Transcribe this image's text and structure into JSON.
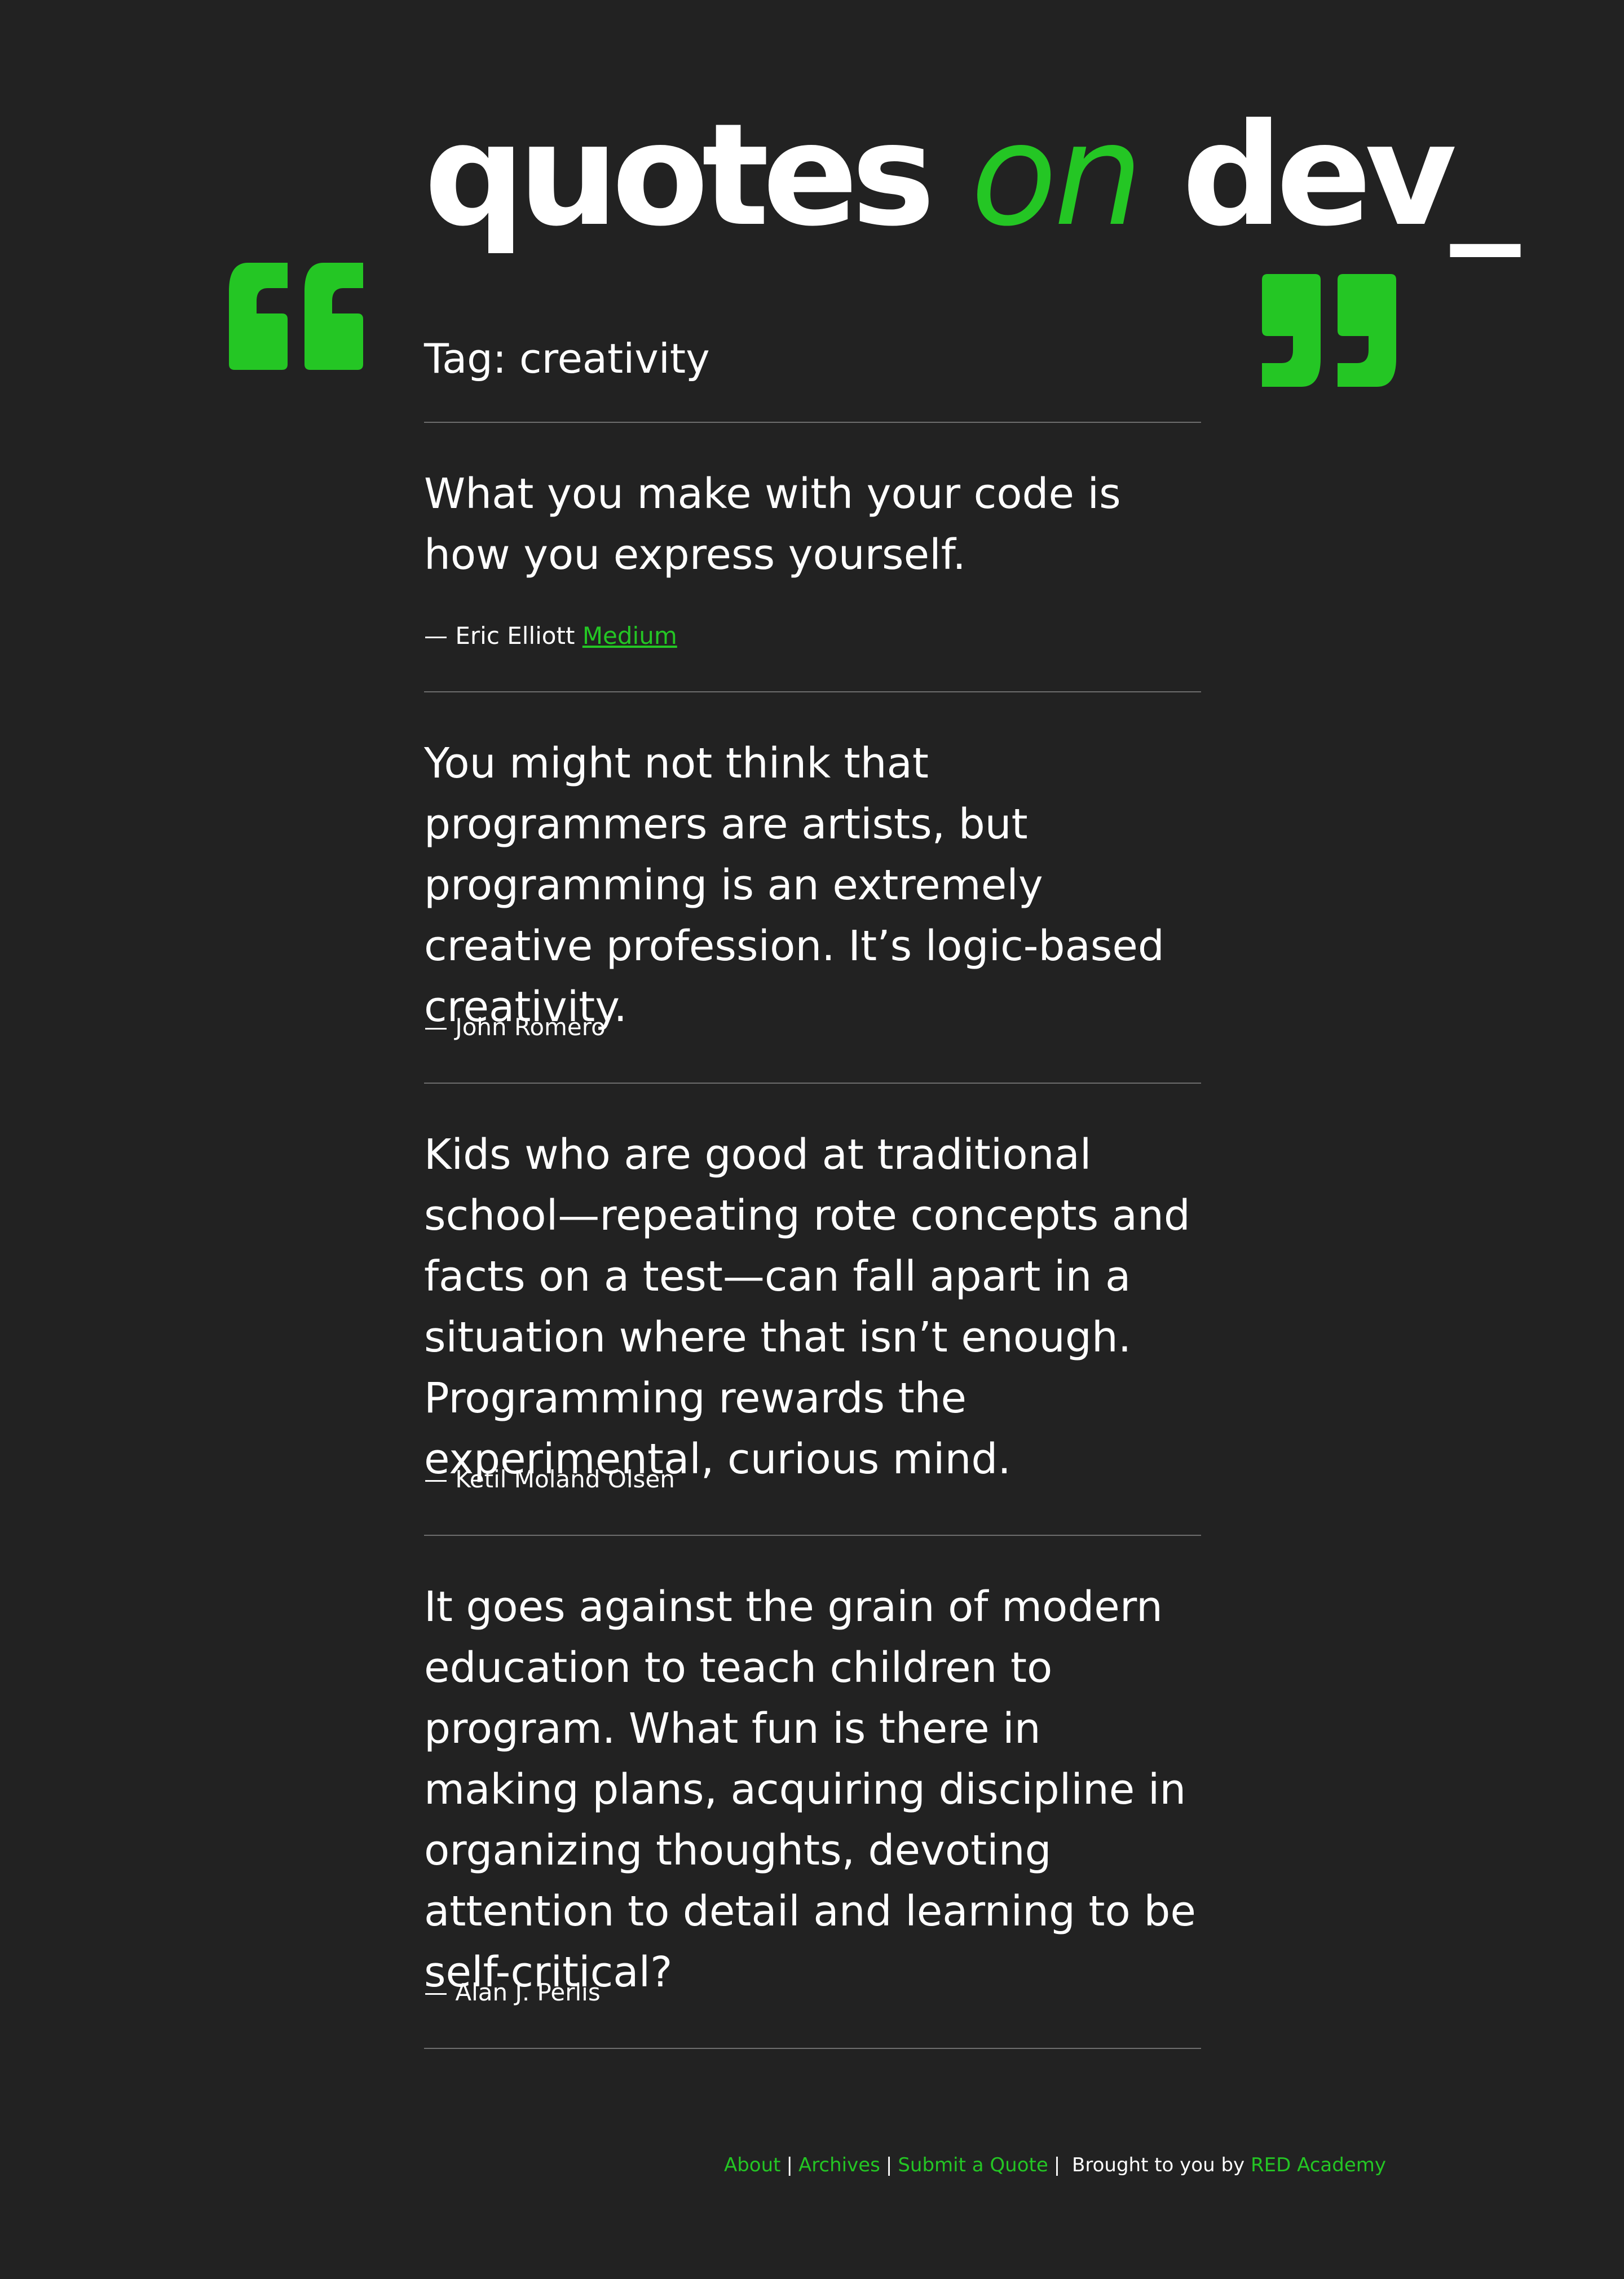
{
  "site": {
    "logo_part1": "quotes ",
    "logo_accent": "on",
    "logo_part2": " dev_"
  },
  "colors": {
    "background": "#222222",
    "accent": "#24c624",
    "text": "#ffffff",
    "rule": "#6e6e6e"
  },
  "icons": {
    "open": "open-quote-icon",
    "close": "close-quote-icon"
  },
  "page": {
    "title": "Tag: creativity"
  },
  "quotes": [
    {
      "text": "What you make with your code is how you express yourself.",
      "author": "— Eric Elliott",
      "source": "Medium"
    },
    {
      "text": "You might not think that programmers are artists, but programming is an extremely creative profession. It’s logic-based creativity.",
      "author": "— John Romero"
    },
    {
      "text": "Kids who are good at traditional school—repeating rote concepts and facts on a test—can fall apart in a situation where that isn’t enough. Programming rewards the experimental, curious mind.",
      "author": "— Ketil Moland Olsen"
    },
    {
      "text": "It goes against the grain of modern education to teach children to program. What fun is there in making plans, acquiring discipline in organizing thoughts, devoting attention to detail and learning to be self-critical?",
      "author": "— Alan J. Perlis"
    }
  ],
  "footer": {
    "links": [
      "About",
      "Archives",
      "Submit a Quote"
    ],
    "separator": "|",
    "credit_prefix": "Brought to you by",
    "credit_link": "RED Academy"
  }
}
